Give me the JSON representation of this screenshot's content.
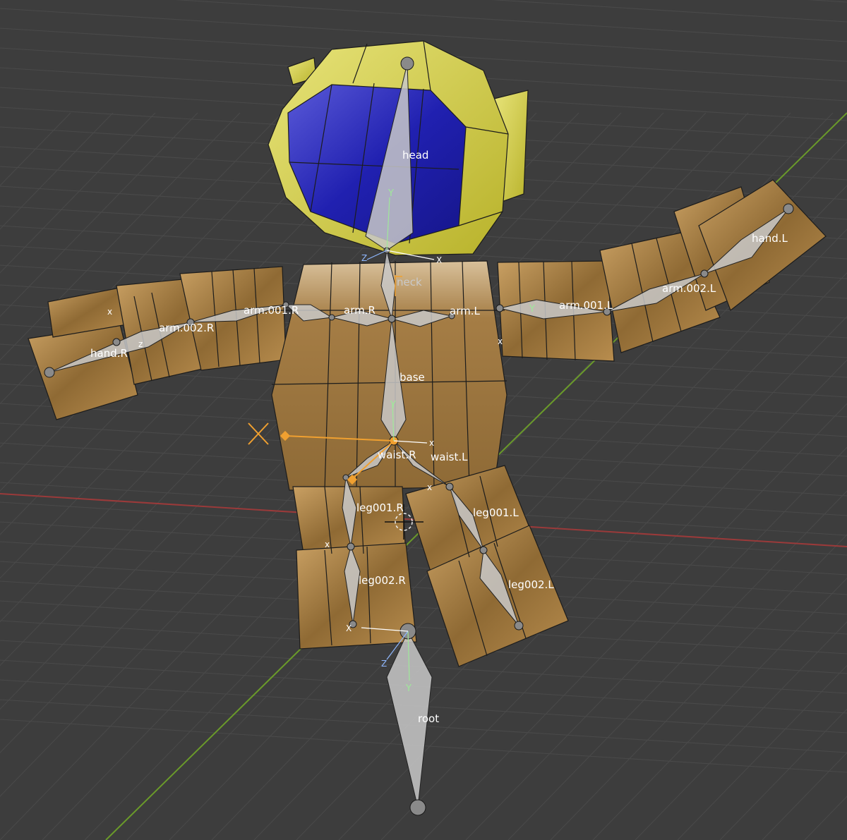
{
  "viewport": {
    "background": "#3d3d3d",
    "x_axis_color": "#9a3a3a",
    "y_axis_color": "#6a9a2a",
    "grid_color": "#4a4a4a",
    "mesh_color": "#b48b4a",
    "helmet_color": "#d4cf3a",
    "visor_color": "#2323b0",
    "bone_fill": "#bfbfbf",
    "selected_color": "#f0a030"
  },
  "bones": [
    {
      "name": "head",
      "label": "head"
    },
    {
      "name": "neck",
      "label": "neck"
    },
    {
      "name": "arm-001-r",
      "label": "arm.001.R"
    },
    {
      "name": "arm-r",
      "label": "arm.R"
    },
    {
      "name": "arm-002-r",
      "label": "arm.002.R"
    },
    {
      "name": "hand-r",
      "label": "hand.R"
    },
    {
      "name": "arm-l",
      "label": "arm.L"
    },
    {
      "name": "arm-001-l",
      "label": "arm.001.L"
    },
    {
      "name": "arm-002-l",
      "label": "arm.002.L"
    },
    {
      "name": "hand-l",
      "label": "hand.L"
    },
    {
      "name": "base",
      "label": "base"
    },
    {
      "name": "waist-r",
      "label": "waist.R"
    },
    {
      "name": "waist-l",
      "label": "waist.L"
    },
    {
      "name": "leg001-r",
      "label": "leg001.R"
    },
    {
      "name": "leg001-l",
      "label": "leg001.L"
    },
    {
      "name": "leg002-r",
      "label": "leg002.R"
    },
    {
      "name": "leg002-l",
      "label": "leg002.L"
    },
    {
      "name": "root",
      "label": "root"
    }
  ],
  "axes": {
    "x": "X",
    "y": "Y",
    "z": "Z",
    "x_lower": "x",
    "z_lower": "z"
  }
}
